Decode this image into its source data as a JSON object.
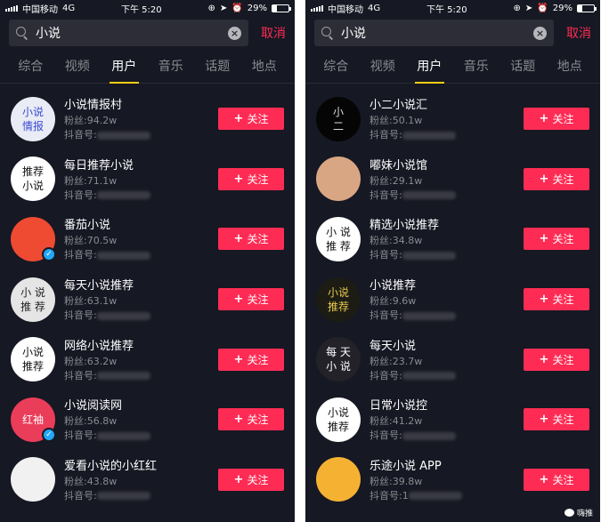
{
  "panels": [
    {
      "status": {
        "carrier": "中国移动",
        "network": "4G",
        "time": "下午 5:20",
        "battery": "29%",
        "battery_level": 0.29
      },
      "search": {
        "query": "小说",
        "cancel": "取消"
      },
      "tabs": [
        "综合",
        "视频",
        "用户",
        "音乐",
        "话题",
        "地点"
      ],
      "users": [
        {
          "name": "小说情报村",
          "fans": "粉丝:94.2w",
          "id_label": "抖音号:",
          "avatar_text": "小说\n情报",
          "avatar_bg": "#e9ecf5",
          "avatar_fg": "#3a4ad1",
          "verified": false
        },
        {
          "name": "每日推荐小说",
          "fans": "粉丝:71.1w",
          "id_label": "抖音号:",
          "avatar_text": "推荐\n小说",
          "avatar_bg": "#ffffff",
          "avatar_fg": "#111111",
          "verified": false
        },
        {
          "name": "番茄小说",
          "fans": "粉丝:70.5w",
          "id_label": "抖音号:",
          "avatar_text": "",
          "avatar_bg": "#ef4a32",
          "avatar_fg": "#ffffff",
          "verified": true
        },
        {
          "name": "每天小说推荐",
          "fans": "粉丝:63.1w",
          "id_label": "抖音号:",
          "avatar_text": "小 说\n推 荐",
          "avatar_bg": "#e5e5e5",
          "avatar_fg": "#222222",
          "verified": false
        },
        {
          "name": "网络小说推荐",
          "fans": "粉丝:63.2w",
          "id_label": "抖音号:",
          "avatar_text": "小说\n推荐",
          "avatar_bg": "#ffffff",
          "avatar_fg": "#111111",
          "verified": false
        },
        {
          "name": "小说阅读网",
          "fans": "粉丝:56.8w",
          "id_label": "抖音号:",
          "avatar_text": "红袖",
          "avatar_bg": "#ea3d5a",
          "avatar_fg": "#ffffff",
          "verified": true
        },
        {
          "name": "爱看小说的小红红",
          "fans": "粉丝:43.8w",
          "id_label": "抖音号:",
          "avatar_text": "",
          "avatar_bg": "#f1f1f1",
          "avatar_fg": "#ff3a8a",
          "verified": false
        }
      ],
      "follow_label": "关注",
      "watermark": ""
    },
    {
      "status": {
        "carrier": "中国移动",
        "network": "4G",
        "time": "下午 5:20",
        "battery": "29%",
        "battery_level": 0.29
      },
      "search": {
        "query": "小说",
        "cancel": "取消"
      },
      "tabs": [
        "综合",
        "视频",
        "用户",
        "音乐",
        "话题",
        "地点"
      ],
      "users": [
        {
          "name": "小二小说汇",
          "fans": "粉丝:50.1w",
          "id_label": "抖音号:",
          "avatar_text": "小\n二",
          "avatar_bg": "#050505",
          "avatar_fg": "#dddddd",
          "verified": false
        },
        {
          "name": "嘟妹小说馆",
          "fans": "粉丝:29.1w",
          "id_label": "抖音号:",
          "avatar_text": "",
          "avatar_bg": "#d9a684",
          "avatar_fg": "#ffffff",
          "verified": false
        },
        {
          "name": "精选小说推荐",
          "fans": "粉丝:34.8w",
          "id_label": "抖音号:",
          "avatar_text": "小 说\n推 荐",
          "avatar_bg": "#ffffff",
          "avatar_fg": "#111111",
          "verified": false
        },
        {
          "name": "小说推荐",
          "fans": "粉丝:9.6w",
          "id_label": "抖音号:",
          "avatar_text": "小说\n推荐",
          "avatar_bg": "#1c1c14",
          "avatar_fg": "#e8c84a",
          "verified": false
        },
        {
          "name": "每天小说",
          "fans": "粉丝:23.7w",
          "id_label": "抖音号:",
          "avatar_text": "每 天\n小 说",
          "avatar_bg": "#222228",
          "avatar_fg": "#ffffff",
          "verified": false
        },
        {
          "name": "日常小说控",
          "fans": "粉丝:41.2w",
          "id_label": "抖音号:",
          "avatar_text": "小说\n推荐",
          "avatar_bg": "#ffffff",
          "avatar_fg": "#111111",
          "verified": false
        },
        {
          "name": "乐途小说 APP",
          "fans": "粉丝:39.8w",
          "id_label": "抖音号:1",
          "avatar_text": "",
          "avatar_bg": "#f5b232",
          "avatar_fg": "#c0392b",
          "verified": false
        }
      ],
      "follow_label": "关注",
      "watermark": "嗨推"
    }
  ]
}
